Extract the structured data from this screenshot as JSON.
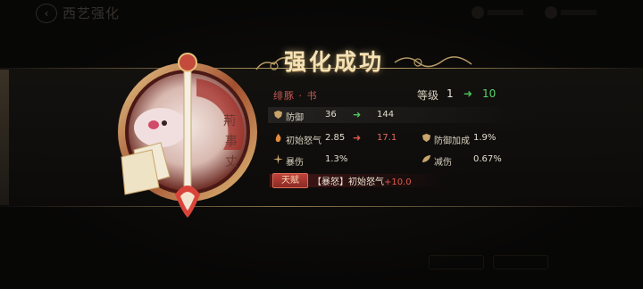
{
  "header": {
    "page_title": "西艺强化",
    "back_icon": "back-arrow-icon"
  },
  "popup": {
    "title": "强化成功",
    "character_name": "绯豚 · 书",
    "level": {
      "label": "等级",
      "from": "1",
      "to": "10"
    },
    "stats": [
      {
        "icon": "shield-icon",
        "label": "防御",
        "from": "36",
        "to": "144",
        "arrow": "green"
      },
      {
        "icon": "flame-icon",
        "label": "初始怒气",
        "from": "2.85",
        "to": "17.1",
        "arrow": "red"
      },
      {
        "icon": "shield-plus-icon",
        "label": "防御加成",
        "value": "1.9%"
      },
      {
        "icon": "burst-icon",
        "label": "暴伤",
        "value": "1.3%"
      },
      {
        "icon": "leaf-icon",
        "label": "减伤",
        "value": "0.67%"
      }
    ],
    "talent": {
      "tag": "天赋",
      "text": "【暴怒】初始怒气",
      "bonus": "+10.0"
    },
    "arrow_glyph": "➜"
  },
  "colors": {
    "title": "#f4e2b6",
    "name": "#c25a55",
    "up_green": "#4fc45d",
    "up_red": "#e05a4b",
    "gold_line": "#c8ab70"
  }
}
